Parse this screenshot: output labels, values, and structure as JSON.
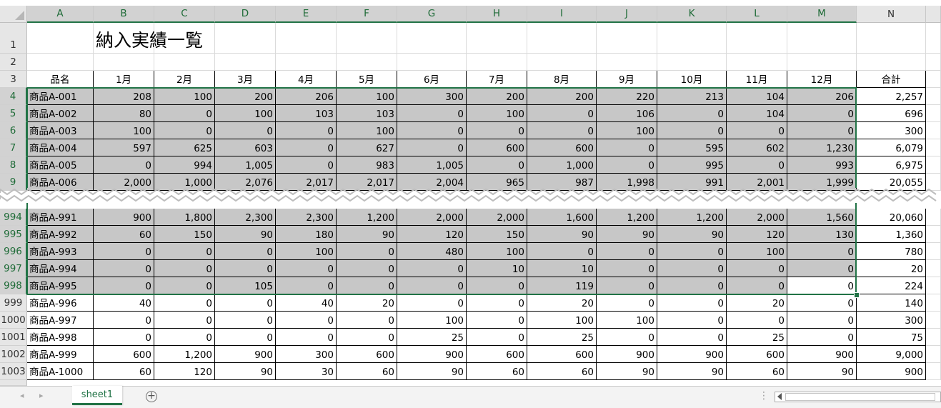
{
  "sheet": {
    "title": "納入実績一覧",
    "columns": [
      "A",
      "B",
      "C",
      "D",
      "E",
      "F",
      "G",
      "H",
      "I",
      "J",
      "K",
      "L",
      "M",
      "N"
    ],
    "selected_columns": [
      "A",
      "B",
      "C",
      "D",
      "E",
      "F",
      "G",
      "H",
      "I",
      "J",
      "K",
      "L",
      "M"
    ],
    "header_row": [
      "品名",
      "1月",
      "2月",
      "3月",
      "4月",
      "5月",
      "6月",
      "7月",
      "8月",
      "9月",
      "10月",
      "11月",
      "12月",
      "合計"
    ],
    "rows_top": [
      {
        "row": "4",
        "selected": true,
        "cells": [
          "商品A-001",
          "208",
          "100",
          "200",
          "206",
          "100",
          "300",
          "200",
          "200",
          "220",
          "213",
          "104",
          "206",
          "2,257"
        ]
      },
      {
        "row": "5",
        "selected": true,
        "cells": [
          "商品A-002",
          "80",
          "0",
          "100",
          "103",
          "103",
          "0",
          "100",
          "0",
          "106",
          "0",
          "104",
          "0",
          "696"
        ]
      },
      {
        "row": "6",
        "selected": true,
        "cells": [
          "商品A-003",
          "100",
          "0",
          "0",
          "0",
          "100",
          "0",
          "0",
          "0",
          "100",
          "0",
          "0",
          "0",
          "300"
        ]
      },
      {
        "row": "7",
        "selected": true,
        "cells": [
          "商品A-004",
          "597",
          "625",
          "603",
          "0",
          "627",
          "0",
          "600",
          "600",
          "0",
          "595",
          "602",
          "1,230",
          "6,079"
        ]
      },
      {
        "row": "8",
        "selected": true,
        "cells": [
          "商品A-005",
          "0",
          "994",
          "1,005",
          "0",
          "983",
          "1,005",
          "0",
          "1,000",
          "0",
          "995",
          "0",
          "993",
          "6,975"
        ]
      },
      {
        "row": "9",
        "selected": true,
        "cells": [
          "商品A-006",
          "2,000",
          "1,000",
          "2,076",
          "2,017",
          "2,017",
          "2,004",
          "965",
          "987",
          "1,998",
          "991",
          "2,001",
          "1,999",
          "20,055"
        ]
      }
    ],
    "rows_bottom": [
      {
        "row": "994",
        "selected": true,
        "cells": [
          "商品A-991",
          "900",
          "1,800",
          "2,300",
          "2,300",
          "1,200",
          "2,000",
          "2,000",
          "1,600",
          "1,200",
          "1,200",
          "2,000",
          "1,560",
          "20,060"
        ]
      },
      {
        "row": "995",
        "selected": true,
        "cells": [
          "商品A-992",
          "60",
          "150",
          "90",
          "180",
          "90",
          "120",
          "150",
          "90",
          "90",
          "90",
          "120",
          "130",
          "1,360"
        ]
      },
      {
        "row": "996",
        "selected": true,
        "cells": [
          "商品A-993",
          "0",
          "0",
          "0",
          "100",
          "0",
          "480",
          "100",
          "0",
          "0",
          "0",
          "100",
          "0",
          "780"
        ]
      },
      {
        "row": "997",
        "selected": true,
        "cells": [
          "商品A-994",
          "0",
          "0",
          "0",
          "0",
          "0",
          "0",
          "10",
          "10",
          "0",
          "0",
          "0",
          "0",
          "20"
        ]
      },
      {
        "row": "998",
        "selected": true,
        "cells": [
          "商品A-995",
          "0",
          "0",
          "105",
          "0",
          "0",
          "0",
          "0",
          "119",
          "0",
          "0",
          "0",
          "0",
          "224"
        ]
      },
      {
        "row": "999",
        "selected": false,
        "cells": [
          "商品A-996",
          "40",
          "0",
          "0",
          "40",
          "20",
          "0",
          "0",
          "20",
          "0",
          "0",
          "20",
          "0",
          "140"
        ]
      },
      {
        "row": "1000",
        "selected": false,
        "cells": [
          "商品A-997",
          "0",
          "0",
          "0",
          "0",
          "0",
          "100",
          "0",
          "100",
          "100",
          "0",
          "0",
          "0",
          "300"
        ]
      },
      {
        "row": "1001",
        "selected": false,
        "cells": [
          "商品A-998",
          "0",
          "0",
          "0",
          "0",
          "0",
          "25",
          "0",
          "25",
          "0",
          "0",
          "25",
          "0",
          "75"
        ]
      },
      {
        "row": "1002",
        "selected": false,
        "cells": [
          "商品A-999",
          "600",
          "1,200",
          "900",
          "300",
          "600",
          "900",
          "600",
          "600",
          "900",
          "900",
          "600",
          "900",
          "9,000"
        ]
      },
      {
        "row": "1003",
        "selected": false,
        "cells": [
          "商品A-1000",
          "60",
          "120",
          "90",
          "30",
          "60",
          "90",
          "60",
          "60",
          "90",
          "90",
          "60",
          "90",
          "900"
        ]
      }
    ],
    "row_labels_static": [
      "1",
      "2",
      "3"
    ]
  },
  "tabs": {
    "sheet_name": "sheet1",
    "add_icon": "plus-circle-icon",
    "nav_prev_icon": "triangle-left-icon",
    "nav_next_icon": "triangle-right-icon"
  },
  "colors": {
    "accent": "#217346",
    "selection_fill": "#c7c7c7",
    "header_fill": "#e6e6e6"
  }
}
